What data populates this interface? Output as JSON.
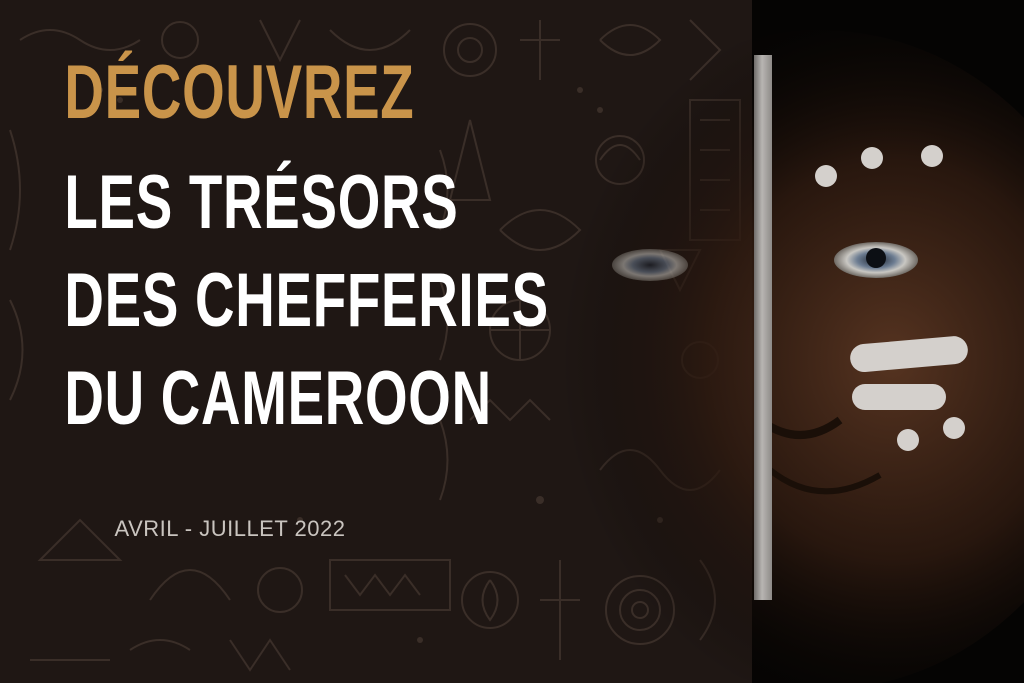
{
  "headline": {
    "line1": "DÉCOUVREZ",
    "line2": "LES TRÉSORS",
    "line3": "DES CHEFFERIES",
    "line4": "DU CAMEROON"
  },
  "dates": "AVRIL - JUILLET 2022",
  "colors": {
    "background": "#1f1714",
    "accent": "#c9944a",
    "headline": "#ffffff",
    "dates": "#c9c4bf",
    "photo_background": "#050403"
  },
  "decorations": [
    "tribal-pattern-background",
    "face-portrait",
    "white-face-paint",
    "silver-divider-bar"
  ]
}
